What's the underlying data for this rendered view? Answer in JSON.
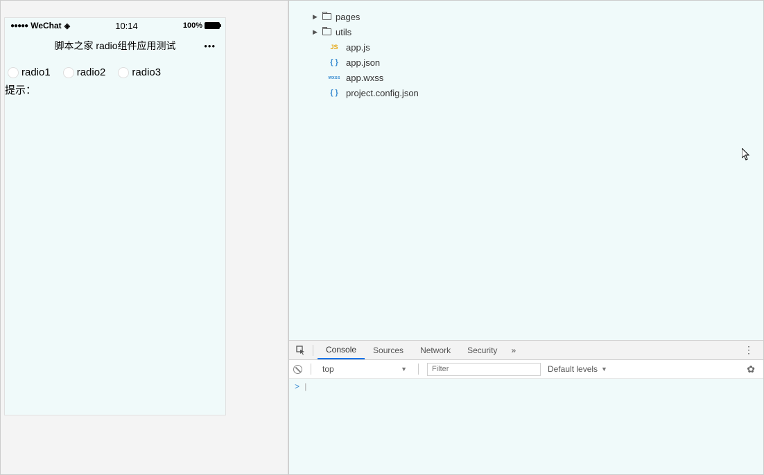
{
  "statusbar": {
    "carrier": "WeChat",
    "time": "10:14",
    "battery_pct": "100%"
  },
  "page": {
    "title": "脚本之家 radio组件应用测试",
    "radios": [
      "radio1",
      "radio2",
      "radio3"
    ],
    "hint_label": "提示："
  },
  "tree": {
    "folders": [
      "pages",
      "utils"
    ],
    "files": [
      {
        "icon": "JS",
        "name": "app.js",
        "cls": "js-icon"
      },
      {
        "icon": "{ }",
        "name": "app.json",
        "cls": "json-icon"
      },
      {
        "icon": "wxss",
        "name": "app.wxss",
        "cls": "wxss-icon"
      },
      {
        "icon": "{ }",
        "name": "project.config.json",
        "cls": "json-icon"
      }
    ]
  },
  "devtools": {
    "tabs": [
      "Console",
      "Sources",
      "Network",
      "Security"
    ],
    "context": "top",
    "filter_placeholder": "Filter",
    "levels": "Default levels",
    "prompt": ">"
  }
}
